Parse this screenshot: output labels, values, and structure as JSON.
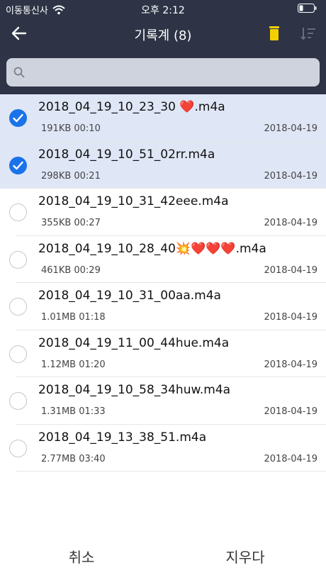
{
  "status_bar": {
    "carrier": "이동통신사",
    "time": "오후 2:12"
  },
  "nav": {
    "title": "기록계 (8)"
  },
  "search": {
    "placeholder": ""
  },
  "recordings": [
    {
      "name": "2018_04_19_10_23_30 ❤️.m4a",
      "meta": "191KB 00:10",
      "date": "2018-04-19",
      "selected": true
    },
    {
      "name": "2018_04_19_10_51_02rr.m4a",
      "meta": "298KB 00:21",
      "date": "2018-04-19",
      "selected": true
    },
    {
      "name": "2018_04_19_10_31_42eee.m4a",
      "meta": "355KB 00:27",
      "date": "2018-04-19",
      "selected": false
    },
    {
      "name": "2018_04_19_10_28_40💥❤️❤️❤️.m4a",
      "meta": "461KB 00:29",
      "date": "2018-04-19",
      "selected": false
    },
    {
      "name": "2018_04_19_10_31_00aa.m4a",
      "meta": "1.01MB 01:18",
      "date": "2018-04-19",
      "selected": false
    },
    {
      "name": "2018_04_19_11_00_44hue.m4a",
      "meta": "1.12MB 01:20",
      "date": "2018-04-19",
      "selected": false
    },
    {
      "name": "2018_04_19_10_58_34huw.m4a",
      "meta": "1.31MB 01:33",
      "date": "2018-04-19",
      "selected": false
    },
    {
      "name": "2018_04_19_13_38_51.m4a",
      "meta": "2.77MB 03:40",
      "date": "2018-04-19",
      "selected": false
    }
  ],
  "bottom": {
    "cancel_label": "취소",
    "delete_label": "지우다"
  },
  "colors": {
    "header": "#2e3446",
    "accent": "#1a73e8",
    "trash": "#f5d000",
    "selected_row": "#dfe6f6"
  }
}
